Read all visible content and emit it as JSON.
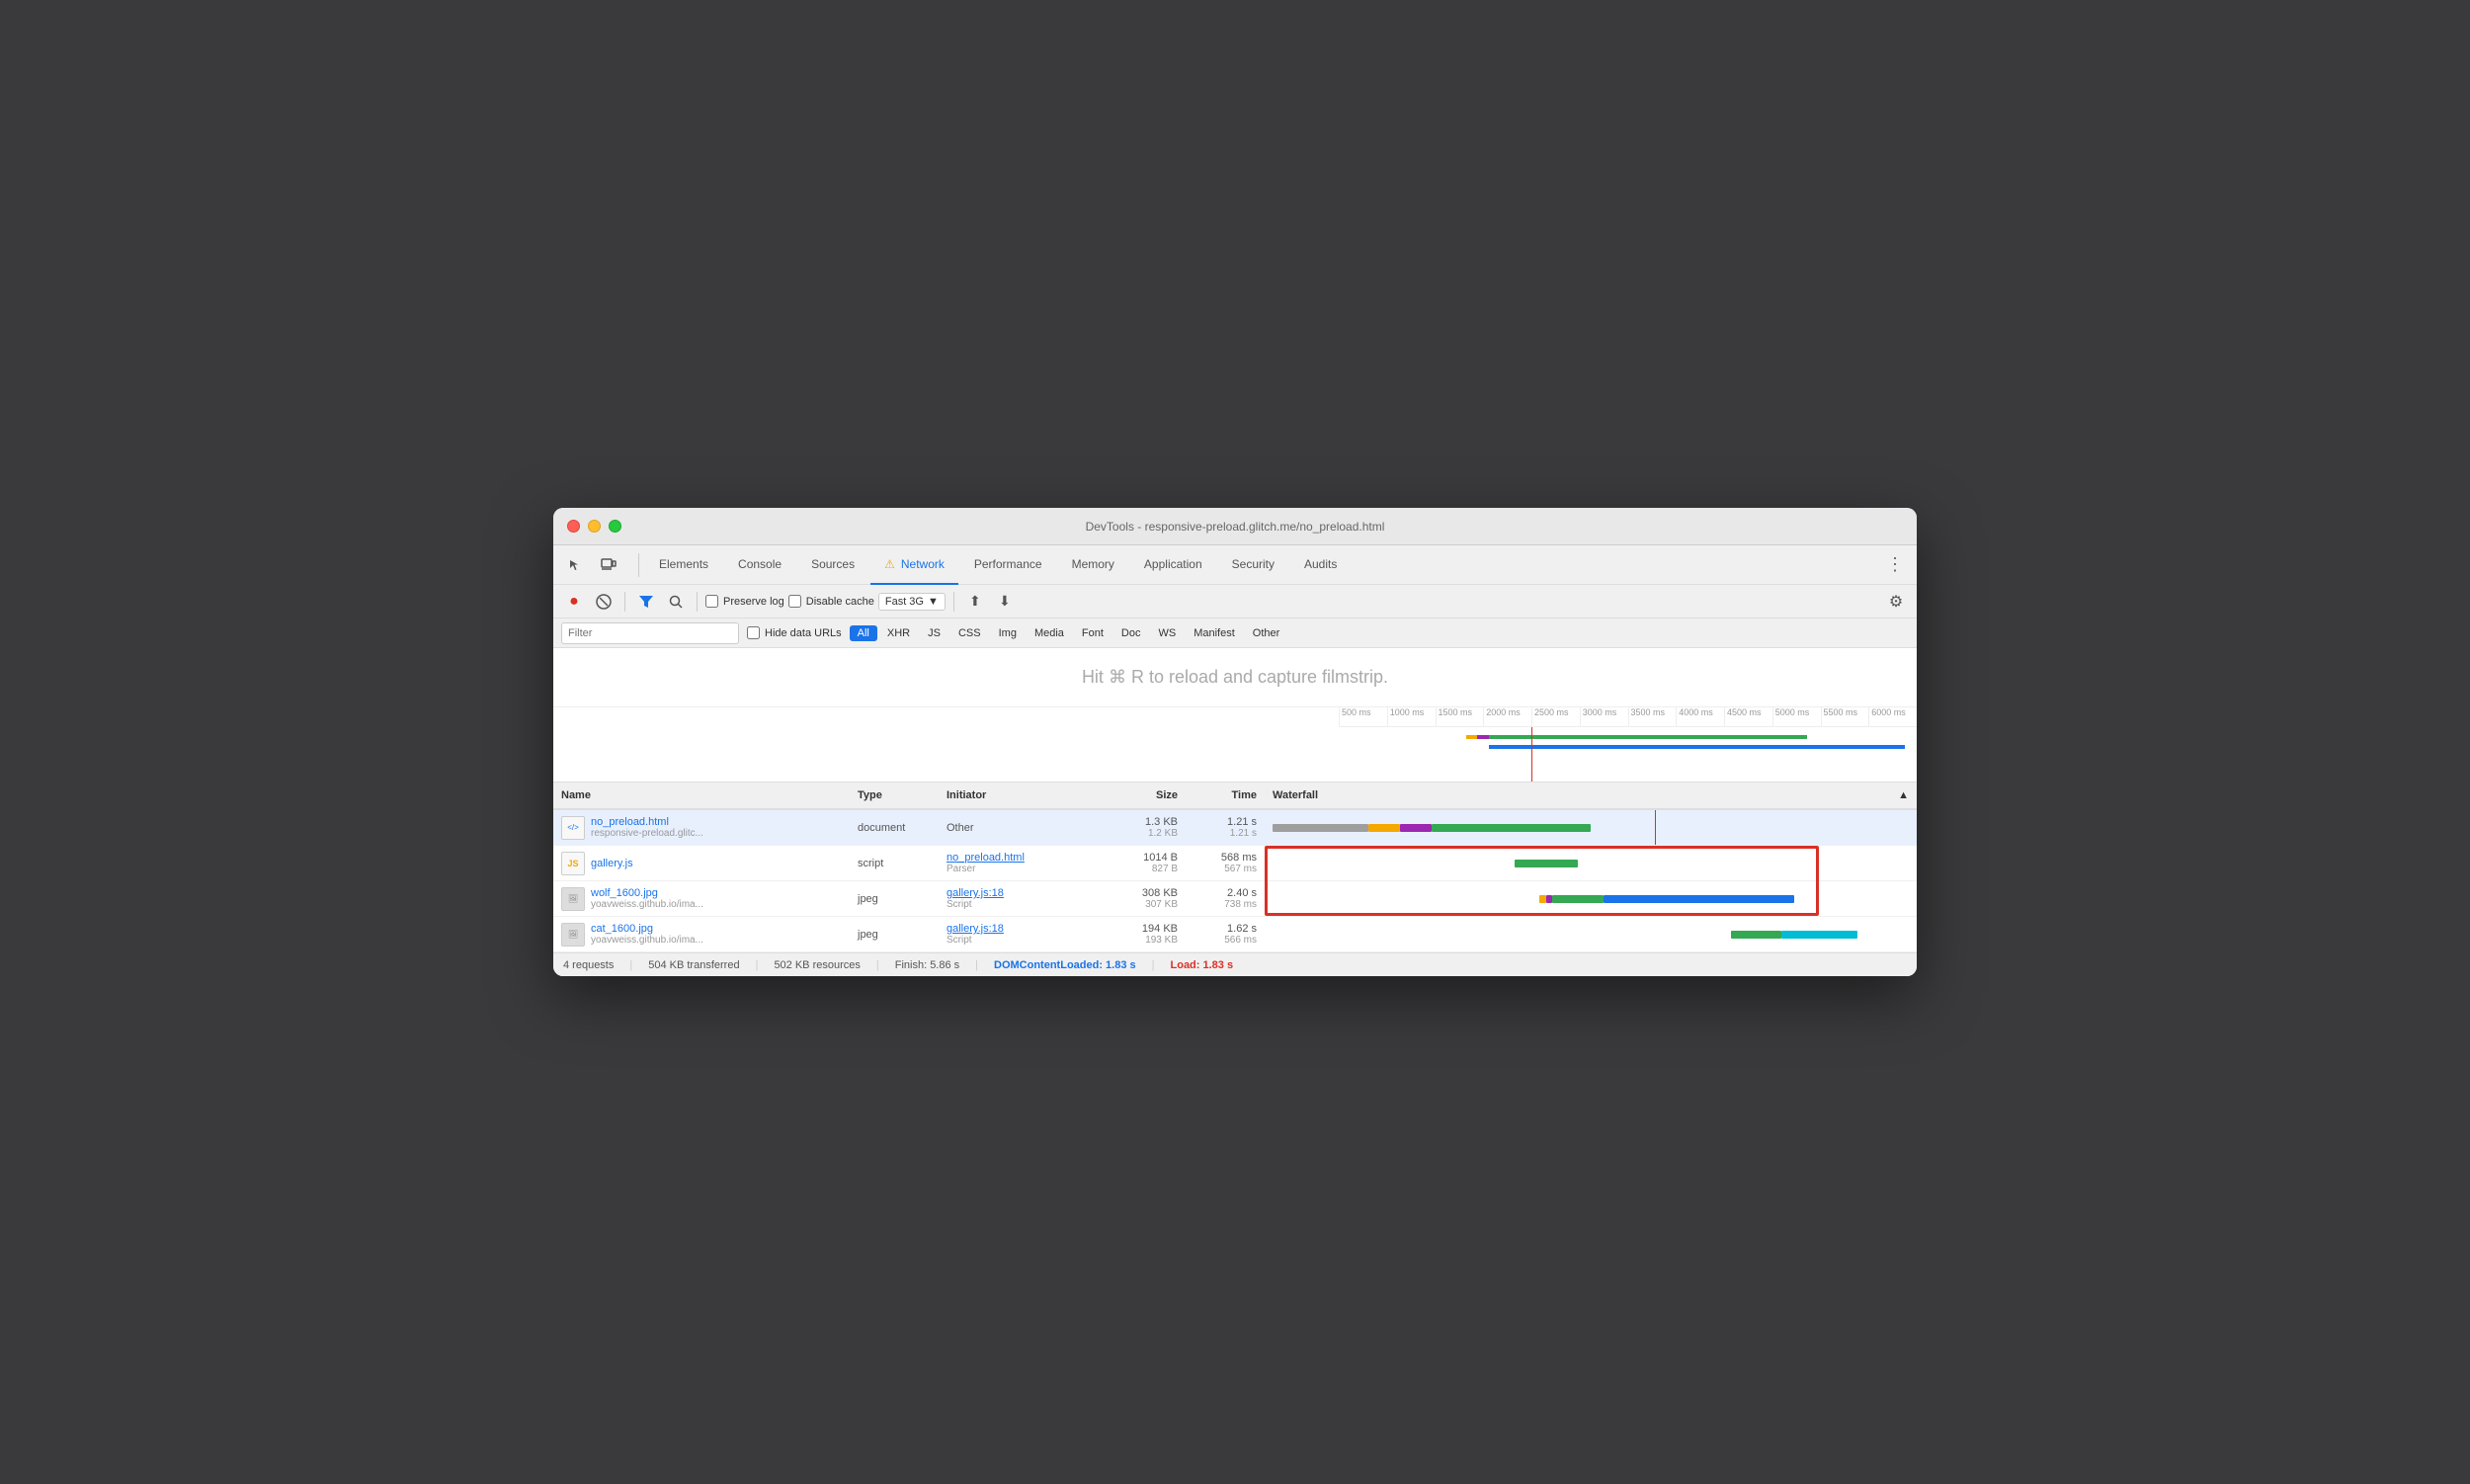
{
  "window": {
    "title": "DevTools - responsive-preload.glitch.me/no_preload.html"
  },
  "traffic_lights": {
    "red": "red",
    "yellow": "yellow",
    "green": "green"
  },
  "tabs": [
    {
      "id": "elements",
      "label": "Elements",
      "active": false
    },
    {
      "id": "console",
      "label": "Console",
      "active": false
    },
    {
      "id": "sources",
      "label": "Sources",
      "active": false
    },
    {
      "id": "network",
      "label": "Network",
      "active": true,
      "warning": true
    },
    {
      "id": "performance",
      "label": "Performance",
      "active": false
    },
    {
      "id": "memory",
      "label": "Memory",
      "active": false
    },
    {
      "id": "application",
      "label": "Application",
      "active": false
    },
    {
      "id": "security",
      "label": "Security",
      "active": false
    },
    {
      "id": "audits",
      "label": "Audits",
      "active": false
    }
  ],
  "toolbar": {
    "record_label": "●",
    "stop_label": "🚫",
    "preserve_log": "Preserve log",
    "disable_cache": "Disable cache",
    "throttle_label": "Fast 3G",
    "upload_icon": "⬆",
    "download_icon": "⬇"
  },
  "filter": {
    "placeholder": "Filter",
    "hide_data_urls": "Hide data URLs",
    "types": [
      "All",
      "XHR",
      "JS",
      "CSS",
      "Img",
      "Media",
      "Font",
      "Doc",
      "WS",
      "Manifest",
      "Other"
    ]
  },
  "filmstrip": {
    "message": "Hit ⌘ R to reload and capture filmstrip."
  },
  "timeline": {
    "labels": [
      "500 ms",
      "1000 ms",
      "1500 ms",
      "2000 ms",
      "2500 ms",
      "3000 ms",
      "3500 ms",
      "4000 ms",
      "4500 ms",
      "5000 ms",
      "5500 ms",
      "6000 ms"
    ]
  },
  "table": {
    "columns": [
      "Name",
      "Type",
      "Initiator",
      "Size",
      "Time",
      "Waterfall"
    ],
    "rows": [
      {
        "id": "no_preload",
        "filename": "no_preload.html",
        "url": "responsive-preload.glitc...",
        "type": "document",
        "initiator": "Other",
        "initiator_link": null,
        "size_transferred": "1.3 KB",
        "size_resource": "1.2 KB",
        "time_total": "1.21 s",
        "time_latency": "1.21 s",
        "selected": true,
        "file_icon": "html"
      },
      {
        "id": "gallery_js",
        "filename": "gallery.js",
        "url": "",
        "type": "script",
        "initiator": "no_preload.html",
        "initiator_sub": "Parser",
        "initiator_link": true,
        "size_transferred": "1014 B",
        "size_resource": "827 B",
        "time_total": "568 ms",
        "time_latency": "567 ms",
        "selected": false,
        "file_icon": "js"
      },
      {
        "id": "wolf_jpg",
        "filename": "wolf_1600.jpg",
        "url": "yoavweiss.github.io/ima...",
        "type": "jpeg",
        "initiator": "gallery.js:18",
        "initiator_sub": "Script",
        "initiator_link": true,
        "size_transferred": "308 KB",
        "size_resource": "307 KB",
        "time_total": "2.40 s",
        "time_latency": "738 ms",
        "selected": false,
        "file_icon": "img"
      },
      {
        "id": "cat_jpg",
        "filename": "cat_1600.jpg",
        "url": "yoavweiss.github.io/ima...",
        "type": "jpeg",
        "initiator": "gallery.js:18",
        "initiator_sub": "Script",
        "initiator_link": true,
        "size_transferred": "194 KB",
        "size_resource": "193 KB",
        "time_total": "1.62 s",
        "time_latency": "566 ms",
        "selected": false,
        "file_icon": "img"
      }
    ]
  },
  "status_bar": {
    "requests": "4 requests",
    "transferred": "504 KB transferred",
    "resources": "502 KB resources",
    "finish": "Finish: 5.86 s",
    "dcl_label": "DOMContentLoaded: 1.83 s",
    "load_label": "Load: 1.83 s"
  }
}
